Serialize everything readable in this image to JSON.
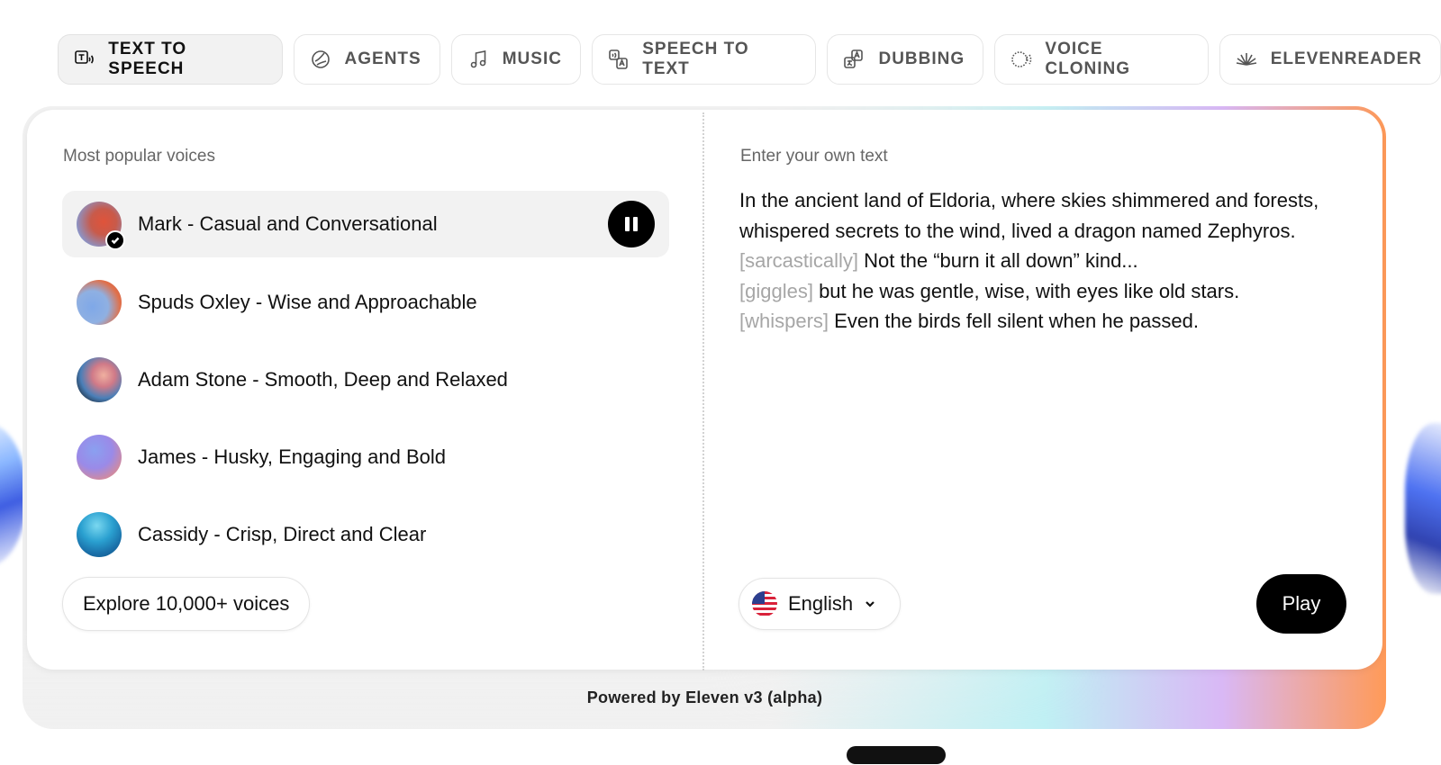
{
  "tabs": [
    {
      "label": "TEXT TO SPEECH",
      "icon": "text-to-speech-icon",
      "active": true
    },
    {
      "label": "AGENTS",
      "icon": "agents-icon",
      "active": false
    },
    {
      "label": "MUSIC",
      "icon": "music-note-icon",
      "active": false
    },
    {
      "label": "SPEECH TO TEXT",
      "icon": "speech-to-text-icon",
      "active": false
    },
    {
      "label": "DUBBING",
      "icon": "dubbing-icon",
      "active": false
    },
    {
      "label": "VOICE CLONING",
      "icon": "voice-cloning-icon",
      "active": false
    },
    {
      "label": "ELEVENREADER",
      "icon": "elevenreader-icon",
      "active": false
    }
  ],
  "voices_panel": {
    "label": "Most popular voices",
    "voices": [
      {
        "name": "Mark - Casual and Conversational",
        "selected": true,
        "playing": true
      },
      {
        "name": "Spuds Oxley - Wise and Approachable",
        "selected": false
      },
      {
        "name": "Adam Stone - Smooth, Deep and Relaxed",
        "selected": false
      },
      {
        "name": "James - Husky, Engaging and Bold",
        "selected": false
      },
      {
        "name": "Cassidy - Crisp, Direct and Clear",
        "selected": false
      }
    ],
    "explore_label": "Explore 10,000+ voices"
  },
  "text_panel": {
    "label": "Enter your own text",
    "segments": [
      {
        "text": "In the ancient land of Eldoria, where skies shimmered and forests, whispered secrets to the wind, lived a dragon named Zephyros. ",
        "tag": false
      },
      {
        "text": "[sarcastically]",
        "tag": true
      },
      {
        "text": " Not the “burn it all down” kind... ",
        "tag": false
      },
      {
        "text": "[giggles]",
        "tag": true
      },
      {
        "text": " but he was gentle, wise, with eyes like old stars. ",
        "tag": false
      },
      {
        "text": "[whispers]",
        "tag": true
      },
      {
        "text": " Even the birds fell silent when he passed.",
        "tag": false
      }
    ],
    "language": "English",
    "play_label": "Play"
  },
  "footer": {
    "powered_by": "Powered by Eleven v3 (alpha)"
  },
  "colors": {
    "accent": "#000000",
    "tag_gray": "#a6a6a6",
    "active_tab_bg": "#f2f2f2"
  }
}
